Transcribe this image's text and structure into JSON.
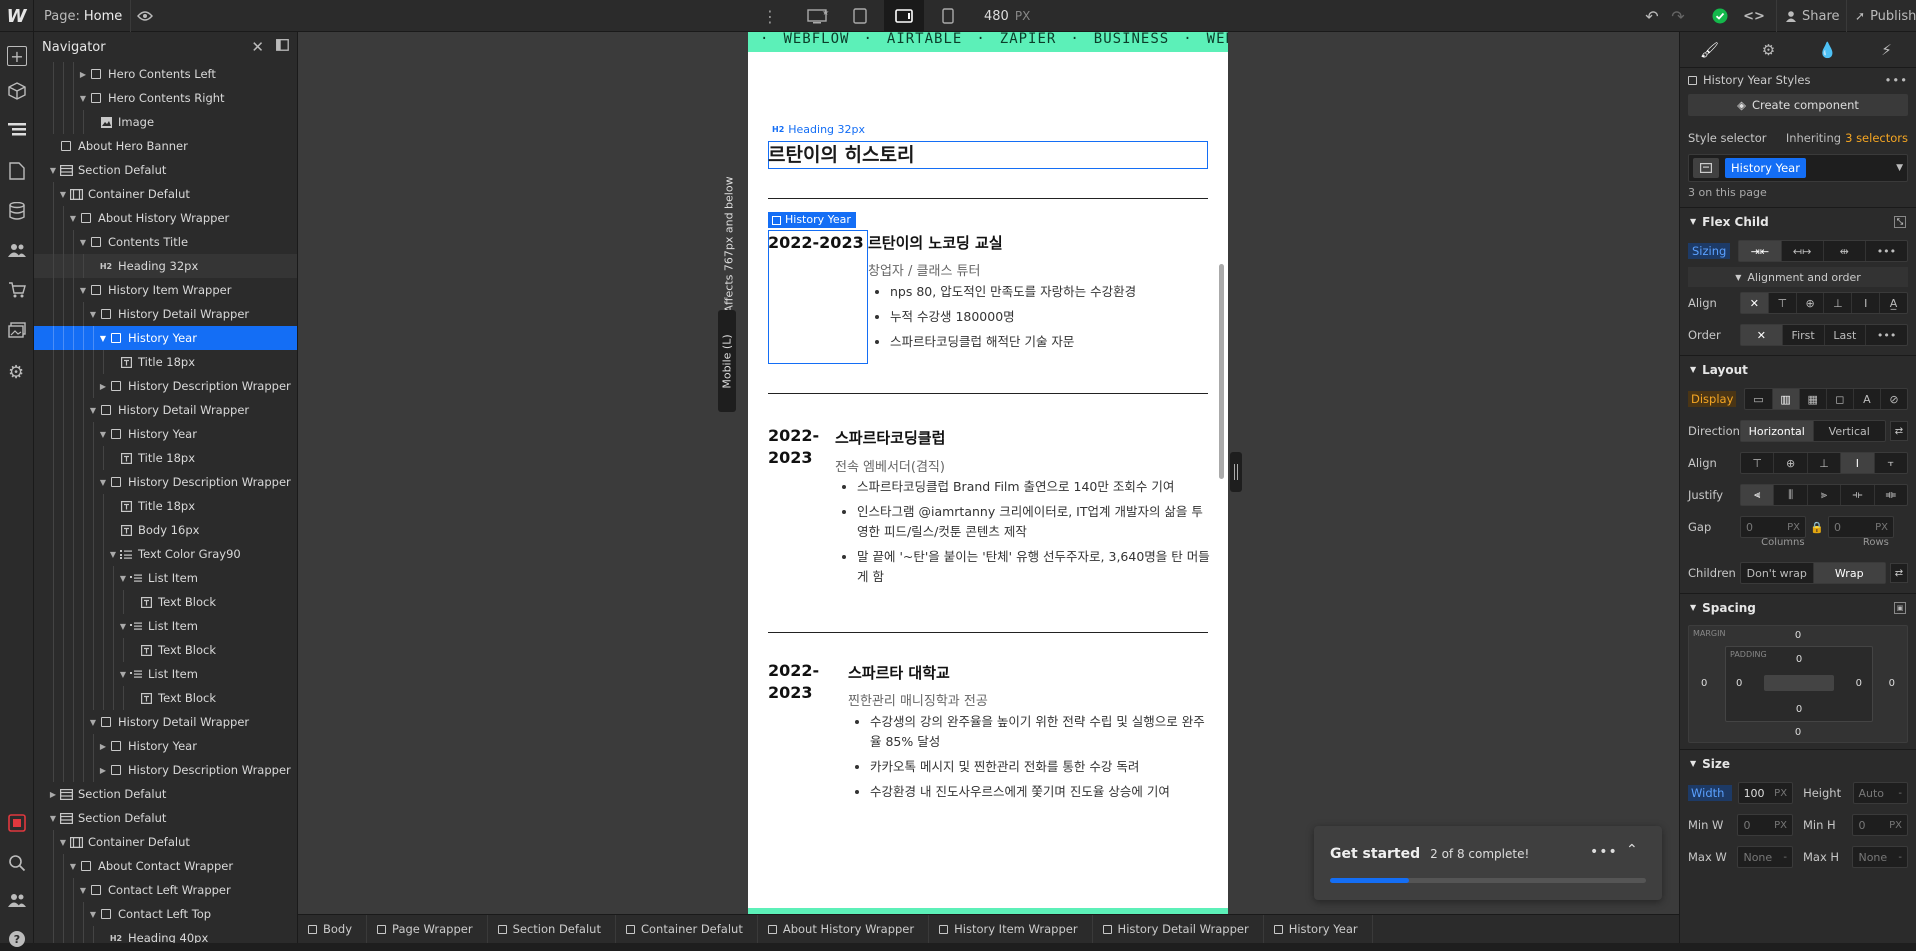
{
  "topbar": {
    "page_label": "Page:",
    "page_name": "Home",
    "width_value": "480",
    "width_unit": "PX",
    "share_label": "Share",
    "publish_label": "Publish"
  },
  "navigator": {
    "title": "Navigator",
    "items": [
      {
        "label": "Hero Contents Left",
        "depth": 5,
        "icon": "box",
        "caret": "right"
      },
      {
        "label": "Hero Contents Right",
        "depth": 5,
        "icon": "box",
        "caret": "down"
      },
      {
        "label": "Image",
        "depth": 6,
        "icon": "image",
        "caret": ""
      },
      {
        "label": "About Hero Banner",
        "depth": 2,
        "icon": "box",
        "caret": ""
      },
      {
        "label": "Section Defalut",
        "depth": 2,
        "icon": "section",
        "caret": "down"
      },
      {
        "label": "Container Defalut",
        "depth": 3,
        "icon": "container",
        "caret": "down"
      },
      {
        "label": "About History Wrapper",
        "depth": 4,
        "icon": "box",
        "caret": "down"
      },
      {
        "label": "Contents Title",
        "depth": 5,
        "icon": "box",
        "caret": "down"
      },
      {
        "label": "Heading 32px",
        "depth": 6,
        "icon": "heading",
        "caret": "",
        "state": "hover"
      },
      {
        "label": "History Item Wrapper",
        "depth": 5,
        "icon": "box",
        "caret": "down"
      },
      {
        "label": "History Detail Wrapper",
        "depth": 6,
        "icon": "box",
        "caret": "down"
      },
      {
        "label": "History Year",
        "depth": 7,
        "icon": "box",
        "caret": "down",
        "state": "selected"
      },
      {
        "label": "Title 18px",
        "depth": 8,
        "icon": "text",
        "caret": ""
      },
      {
        "label": "History Description Wrapper",
        "depth": 7,
        "icon": "box",
        "caret": "right"
      },
      {
        "label": "History Detail Wrapper",
        "depth": 6,
        "icon": "box",
        "caret": "down"
      },
      {
        "label": "History Year",
        "depth": 7,
        "icon": "box",
        "caret": "down"
      },
      {
        "label": "Title 18px",
        "depth": 8,
        "icon": "text",
        "caret": ""
      },
      {
        "label": "History Description Wrapper",
        "depth": 7,
        "icon": "box",
        "caret": "down"
      },
      {
        "label": "Title 18px",
        "depth": 8,
        "icon": "text",
        "caret": ""
      },
      {
        "label": "Body 16px",
        "depth": 8,
        "icon": "text",
        "caret": ""
      },
      {
        "label": "Text Color Gray90",
        "depth": 8,
        "icon": "list",
        "caret": "down"
      },
      {
        "label": "List Item",
        "depth": 9,
        "icon": "listitem",
        "caret": "down"
      },
      {
        "label": "Text Block",
        "depth": 10,
        "icon": "text",
        "caret": ""
      },
      {
        "label": "List Item",
        "depth": 9,
        "icon": "listitem",
        "caret": "down"
      },
      {
        "label": "Text Block",
        "depth": 10,
        "icon": "text",
        "caret": ""
      },
      {
        "label": "List Item",
        "depth": 9,
        "icon": "listitem",
        "caret": "down"
      },
      {
        "label": "Text Block",
        "depth": 10,
        "icon": "text",
        "caret": ""
      },
      {
        "label": "History Detail Wrapper",
        "depth": 6,
        "icon": "box",
        "caret": "down"
      },
      {
        "label": "History Year",
        "depth": 7,
        "icon": "box",
        "caret": "right"
      },
      {
        "label": "History Description Wrapper",
        "depth": 7,
        "icon": "box",
        "caret": "right"
      },
      {
        "label": "Section Defalut",
        "depth": 2,
        "icon": "section",
        "caret": "right"
      },
      {
        "label": "Section Defalut",
        "depth": 2,
        "icon": "section",
        "caret": "down"
      },
      {
        "label": "Container Defalut",
        "depth": 3,
        "icon": "container",
        "caret": "down"
      },
      {
        "label": "About Contact Wrapper",
        "depth": 4,
        "icon": "box",
        "caret": "down"
      },
      {
        "label": "Contact Left Wrapper",
        "depth": 5,
        "icon": "box",
        "caret": "down"
      },
      {
        "label": "Contact Left Top",
        "depth": 6,
        "icon": "box",
        "caret": "down"
      },
      {
        "label": "Heading 40px",
        "depth": 7,
        "icon": "heading",
        "caret": ""
      }
    ]
  },
  "canvas": {
    "breakpoint_note": "Affects 767px and below",
    "breakpoint_name": "Mobile (L)",
    "marquee": [
      "WEBFLOW",
      "AIRTABLE",
      "ZAPIER",
      "BUSINESS",
      "WEBFLO"
    ],
    "heading_badge": "Heading 32px",
    "heading": "르탄이의 히스토리",
    "selected_badge": "History Year",
    "history": [
      {
        "year": "2022-2023",
        "title": "르탄이의 노코딩 교실",
        "role": "창업자 / 클래스 튜터",
        "bullets": [
          "nps 80, 압도적인 만족도를 자랑하는 수강환경",
          "누적 수강생 180000명",
          "스파르타코딩클럽 해적단 기술 자문"
        ]
      },
      {
        "year": "2022-\n2023",
        "title": "스파르타코딩클럽",
        "role": "전속 엠베서더(겸직)",
        "bullets": [
          "스파르타코딩클럽 Brand Film 출연으로 140만 조회수 기여",
          "인스타그램 @iamrtanny 크리에이터로, IT업계 개발자의 삶을 투영한 피드/릴스/컷툰 콘텐츠 제작",
          "말 끝에 '~탄'을 붙이는 '탄체' 유행 선두주자로, 3,640명을 탄 머들게 함"
        ]
      },
      {
        "year": "2022-\n2023",
        "title": "스파르타 대학교",
        "role": "찐한관리 매니징학과 전공",
        "bullets": [
          "수강생의 강의 완주율을 높이기 위한 전략 수립 및 실행으로 완주율 85% 달성",
          "카카오톡 메시지 및 찐한관리 전화를 통한 수강 독려",
          "수강환경 내 진도사우르스에게 쫓기며 진도율 상승에 기여"
        ]
      }
    ]
  },
  "get_started": {
    "title": "Get started",
    "progress_text": "2 of 8 complete!",
    "progress": 0.25
  },
  "breadcrumbs": [
    "Body",
    "Page Wrapper",
    "Section Defalut",
    "Container Defalut",
    "About History Wrapper",
    "History Item Wrapper",
    "History Detail Wrapper",
    "History Year"
  ],
  "style_panel": {
    "class_header": "History Year Styles",
    "create_component": "Create component",
    "style_selector_label": "Style selector",
    "inheriting_prefix": "Inheriting",
    "inheriting_count": "3 selectors",
    "selector_chip": "History Year",
    "on_page": "3 on this page",
    "flex_child": {
      "title": "Flex Child",
      "sizing_label": "Sizing",
      "alignment_order": "Alignment and order",
      "align_label": "Align",
      "order_label": "Order",
      "order_first": "First",
      "order_last": "Last"
    },
    "layout": {
      "title": "Layout",
      "display_label": "Display",
      "direction_label": "Direction",
      "dir_horizontal": "Horizontal",
      "dir_vertical": "Vertical",
      "align_label": "Align",
      "justify_label": "Justify",
      "gap_label": "Gap",
      "gap_cols": "0",
      "gap_rows": "0",
      "gap_unit": "PX",
      "cols_label": "Columns",
      "rows_label": "Rows",
      "children_label": "Children",
      "dont_wrap": "Don't wrap",
      "wrap": "Wrap"
    },
    "spacing": {
      "title": "Spacing",
      "margin_label": "MARGIN",
      "padding_label": "PADDING",
      "margin_top": "0",
      "margin_right": "0",
      "margin_bottom": "0",
      "margin_left": "0",
      "padding_top": "0",
      "padding_right": "0",
      "padding_bottom": "0",
      "padding_left": "0"
    },
    "size": {
      "title": "Size",
      "width_label": "Width",
      "width_value": "100",
      "width_unit": "PX",
      "height_label": "Height",
      "height_value": "Auto",
      "min_w_label": "Min W",
      "min_w_value": "0",
      "min_h_label": "Min H",
      "min_h_value": "0",
      "max_w_label": "Max W",
      "max_w_value": "None",
      "max_h_label": "Max H",
      "max_h_value": "None",
      "unit_px": "PX"
    }
  },
  "colors": {
    "accent": "#146ef5",
    "marquee": "#5cf0b8",
    "warning": "#f5a623",
    "success": "#14b84b"
  }
}
